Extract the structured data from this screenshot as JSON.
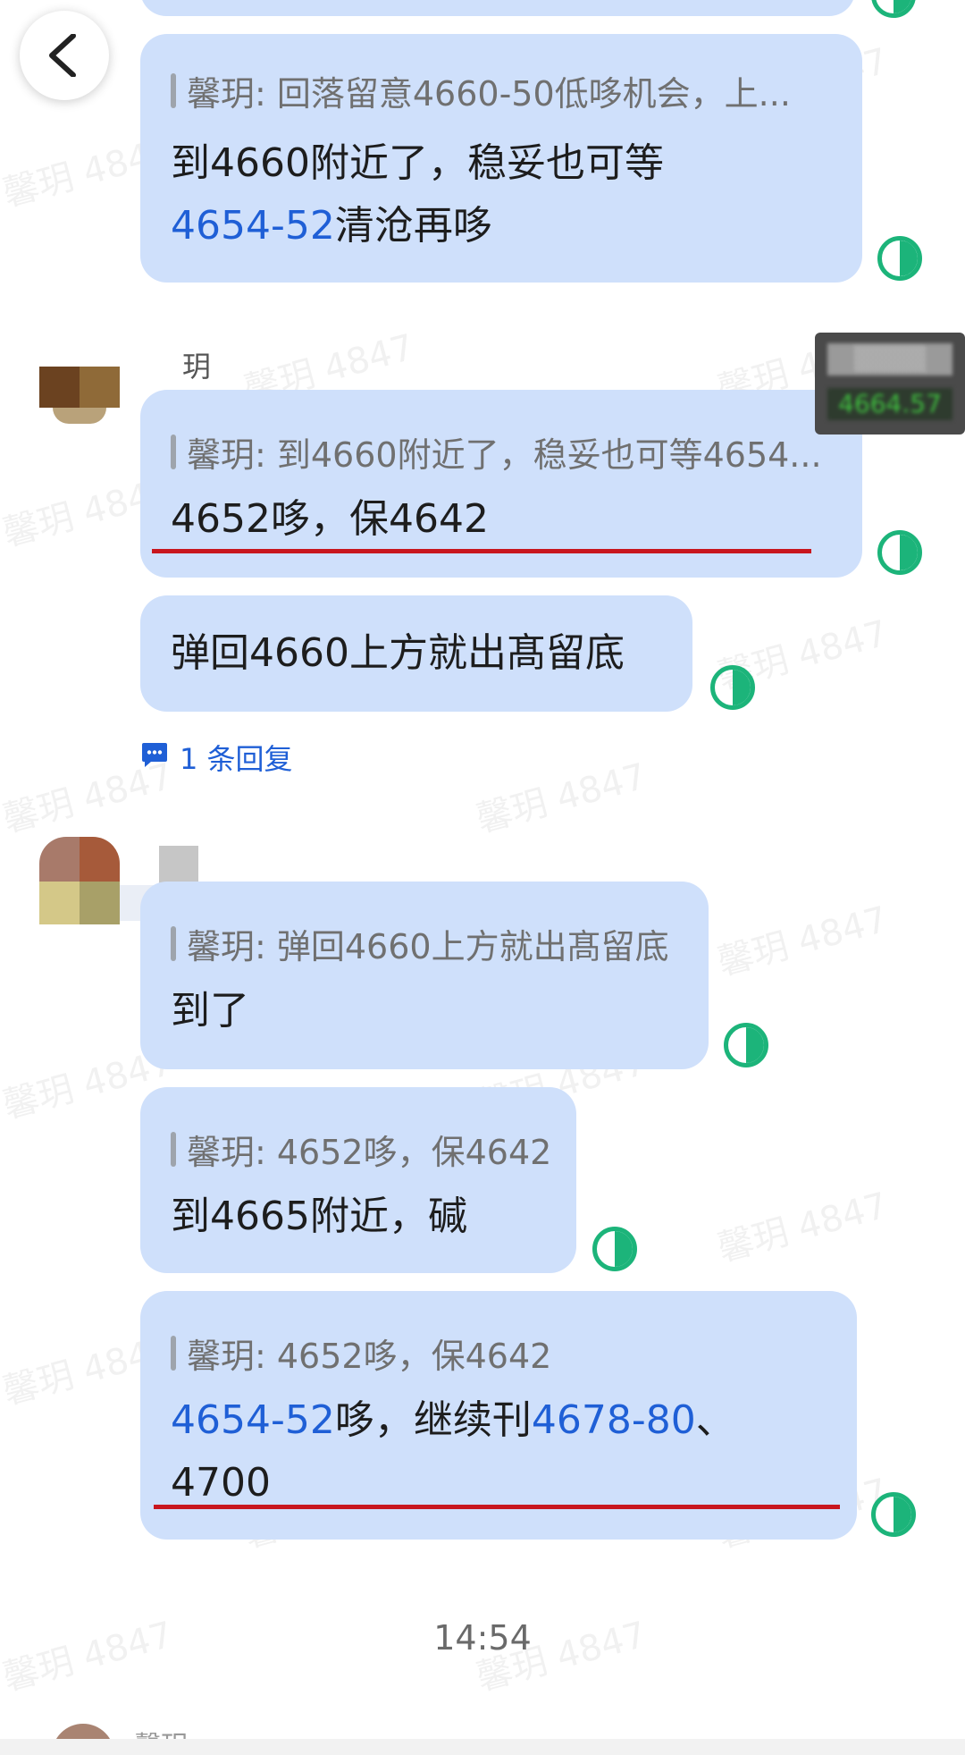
{
  "nav": {
    "back_icon": "chevron-left-icon"
  },
  "watermark": "馨玥 4847",
  "floating_widget": {
    "top": "▒▒▒▒",
    "bottom": "4664.57"
  },
  "messages": [
    {
      "quote": "馨玥: 回落留意4660-50低哆机会，上...",
      "line1": "到4660附近了，稳妥也可等",
      "line2_blue": "4654-52",
      "line2_rest": "清沧再哆"
    },
    {
      "quote": "馨玥: 到4660附近了，稳妥也可等4654...",
      "text": "4652哆，保4642"
    },
    {
      "text": "弹回4660上方就出髙留底"
    },
    {
      "quote": "馨玥: 弹回4660上方就出髙留底",
      "text": "到了"
    },
    {
      "quote": "馨玥: 4652哆，保4642",
      "text": "到4665附近，碱"
    },
    {
      "quote": "馨玥: 4652哆，保4642",
      "seg1": "4654-52",
      "seg2": "哆，继续刊",
      "seg3": "4678-80",
      "seg4": "、",
      "line2": "4700"
    }
  ],
  "sender_partial": "玥",
  "reply_link": {
    "icon": "comment-icon",
    "label": "1 条回复"
  },
  "timestamp": "14:54",
  "bottom_partial": "馨玥"
}
